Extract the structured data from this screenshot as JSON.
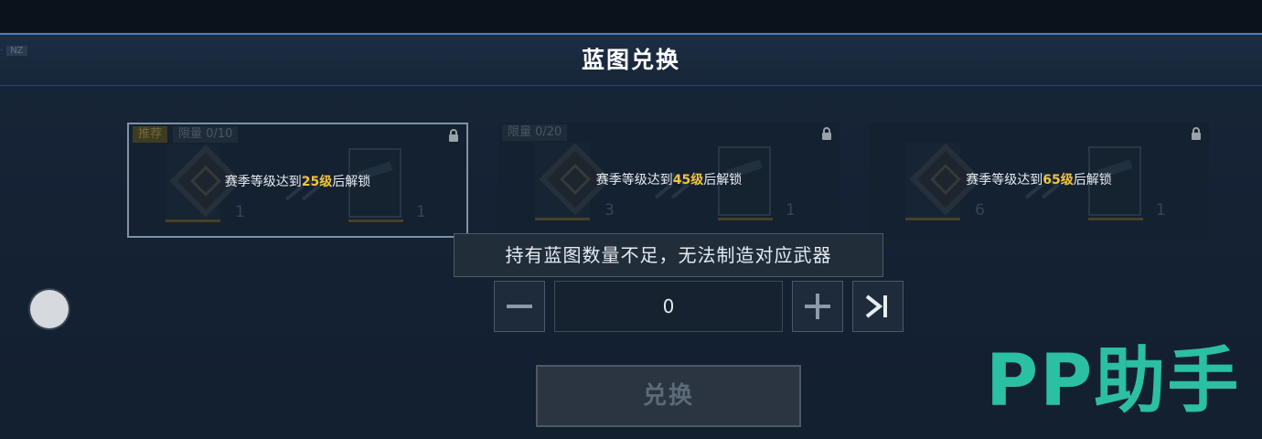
{
  "header": {
    "title": "蓝图兑换",
    "faded_left_text": "·",
    "faded_left_chip": "NZ",
    "faded_left_sub": ""
  },
  "cards": [
    {
      "tags": [
        "推荐",
        "限量 0/10"
      ],
      "unlock_prefix": "赛季等级达到",
      "unlock_level": "25级",
      "unlock_suffix": "后解锁",
      "input_count": "1",
      "output_count": "1",
      "selected": true
    },
    {
      "tags": [
        "限量 0/20"
      ],
      "unlock_prefix": "赛季等级达到",
      "unlock_level": "45级",
      "unlock_suffix": "后解锁",
      "input_count": "3",
      "output_count": "1",
      "selected": false
    },
    {
      "tags": [],
      "unlock_prefix": "赛季等级达到",
      "unlock_level": "65级",
      "unlock_suffix": "后解锁",
      "input_count": "6",
      "output_count": "1",
      "selected": false
    }
  ],
  "tooltip": {
    "text": "持有蓝图数量不足，无法制造对应武器"
  },
  "quantity": {
    "value": "0"
  },
  "exchange_button": {
    "label": "兑换",
    "mini_left": "",
    "mini_right": ""
  },
  "watermark": {
    "text": "PP助手"
  },
  "colors": {
    "accent_level": "#f2c33d",
    "watermark": "#2bbfa4",
    "header_border": "#4d7fb8"
  },
  "icons": [
    "lock-icon",
    "minus-icon",
    "plus-icon",
    "max-icon",
    "blueprint-box-icon",
    "weapon-icon",
    "arrow-right-icon"
  ]
}
